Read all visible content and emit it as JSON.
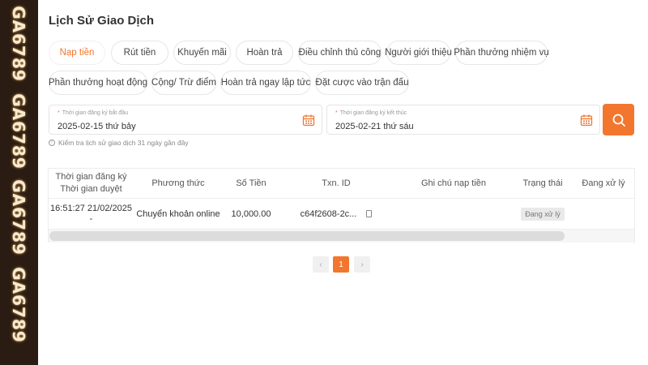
{
  "sidebar": {
    "watermark": "GA6789"
  },
  "page_title": "Lịch Sử Giao Dịch",
  "tabs": [
    {
      "label": "Nạp tiền",
      "active": true
    },
    {
      "label": "Rút tiền"
    },
    {
      "label": "Khuyến mãi"
    },
    {
      "label": "Hoàn trả"
    },
    {
      "label": "Điều chỉnh thủ công"
    },
    {
      "label": "Người giới thiệu"
    },
    {
      "label": "Phần thưởng nhiệm vụ"
    },
    {
      "label": "Phần thưởng hoạt động"
    },
    {
      "label": "Cộng/ Trừ điểm"
    },
    {
      "label": "Hoàn trả ngay lập tức"
    },
    {
      "label": "Đặt cược vào trận đấu"
    }
  ],
  "filters": {
    "start": {
      "required_mark": "*",
      "label": "Thời gian đăng ký bắt đầu",
      "value": "2025-02-15 thứ bảy"
    },
    "end": {
      "required_mark": "*",
      "label": "Thời gian đăng ký kết thúc",
      "value": "2025-02-21 thứ sáu"
    }
  },
  "note": {
    "icon": "info-icon",
    "text": "Kiểm tra lịch sử giao dịch 31 ngày gần đây"
  },
  "table": {
    "headers": {
      "time_line1": "Thời gian đăng ký",
      "time_line2": "Thời gian duyệt",
      "method": "Phương thức",
      "amount": "Số Tiền",
      "txn": "Txn. ID",
      "note": "Ghi chú nạp tiền",
      "status": "Trạng thái",
      "processing": "Đang xử lý"
    },
    "rows": [
      {
        "time_line1": "16:51:27 21/02/2025",
        "time_line2": "-",
        "method": "Chuyển khoản online",
        "amount": "10,000.00",
        "txn": "c64f2608-2c...",
        "status": "Đang xử lý"
      }
    ]
  },
  "pagination": {
    "prev": "‹",
    "current": "1",
    "next": "›"
  },
  "colors": {
    "accent": "#f2762e",
    "sidebar": "#2a1c12"
  }
}
